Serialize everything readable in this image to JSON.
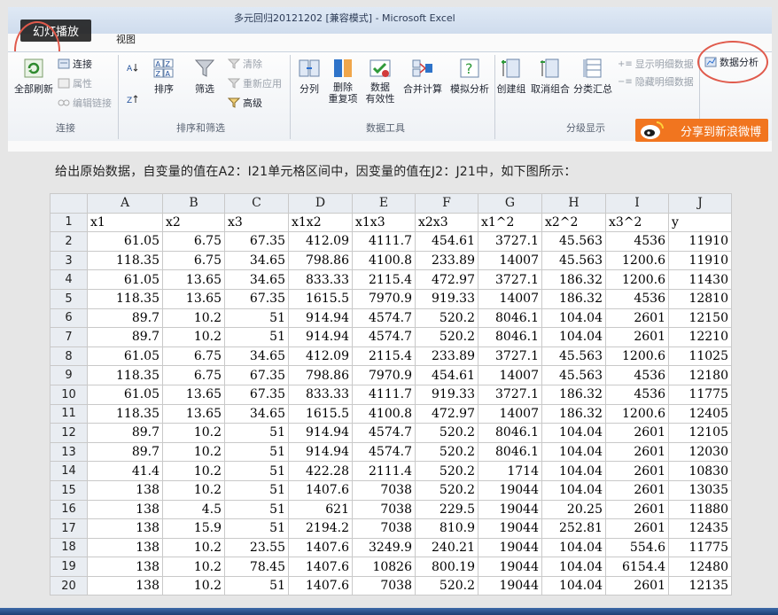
{
  "window": {
    "title": "多元回归20121202  [兼容模式]  -  Microsoft Excel"
  },
  "overlay": {
    "slideshow_label": "幻灯播放"
  },
  "tabs": [
    "视图"
  ],
  "ribbon": {
    "connections": {
      "refresh_all": "全部刷新",
      "connect": "连接",
      "properties": "属性",
      "edit_links": "编辑链接",
      "group": "连接"
    },
    "sort_filter": {
      "sort": "排序",
      "filter": "筛选",
      "clear": "清除",
      "reapply": "重新应用",
      "advanced": "高级",
      "group": "排序和筛选"
    },
    "data_tools": {
      "text_to_columns": "分列",
      "remove_duplicates_1": "删除",
      "remove_duplicates_2": "重复项",
      "validation_1": "数据",
      "validation_2": "有效性",
      "consolidate": "合并计算",
      "what_if": "模拟分析",
      "group": "数据工具"
    },
    "outline": {
      "group_btn": "创建组",
      "ungroup": "取消组合",
      "subtotal": "分类汇总",
      "show_detail": "显示明细数据",
      "hide_detail": "隐藏明细数据",
      "group": "分级显示"
    },
    "analysis": {
      "data_analysis": "数据分析"
    }
  },
  "share": {
    "label": "分享到新浪微博"
  },
  "caption": "给出原始数据，自变量的值在A2：I21单元格区间中，因变量的值在J2：J21中，如下图所示：",
  "sheet": {
    "columns": [
      "A",
      "B",
      "C",
      "D",
      "E",
      "F",
      "G",
      "H",
      "I",
      "J"
    ],
    "rows": [
      {
        "num": "1",
        "cells": [
          "x1",
          "x2",
          "x3",
          "x1x2",
          "x1x3",
          "x2x3",
          "x1^2",
          "x2^2",
          "x3^2",
          "y"
        ]
      },
      {
        "num": "2",
        "cells": [
          "61.05",
          "6.75",
          "67.35",
          "412.09",
          "4111.7",
          "454.61",
          "3727.1",
          "45.563",
          "4536",
          "11910"
        ]
      },
      {
        "num": "3",
        "cells": [
          "118.35",
          "6.75",
          "34.65",
          "798.86",
          "4100.8",
          "233.89",
          "14007",
          "45.563",
          "1200.6",
          "11910"
        ]
      },
      {
        "num": "4",
        "cells": [
          "61.05",
          "13.65",
          "34.65",
          "833.33",
          "2115.4",
          "472.97",
          "3727.1",
          "186.32",
          "1200.6",
          "11430"
        ]
      },
      {
        "num": "5",
        "cells": [
          "118.35",
          "13.65",
          "67.35",
          "1615.5",
          "7970.9",
          "919.33",
          "14007",
          "186.32",
          "4536",
          "12810"
        ]
      },
      {
        "num": "6",
        "cells": [
          "89.7",
          "10.2",
          "51",
          "914.94",
          "4574.7",
          "520.2",
          "8046.1",
          "104.04",
          "2601",
          "12150"
        ]
      },
      {
        "num": "7",
        "cells": [
          "89.7",
          "10.2",
          "51",
          "914.94",
          "4574.7",
          "520.2",
          "8046.1",
          "104.04",
          "2601",
          "12210"
        ]
      },
      {
        "num": "8",
        "cells": [
          "61.05",
          "6.75",
          "34.65",
          "412.09",
          "2115.4",
          "233.89",
          "3727.1",
          "45.563",
          "1200.6",
          "11025"
        ]
      },
      {
        "num": "9",
        "cells": [
          "118.35",
          "6.75",
          "67.35",
          "798.86",
          "7970.9",
          "454.61",
          "14007",
          "45.563",
          "4536",
          "12180"
        ]
      },
      {
        "num": "10",
        "cells": [
          "61.05",
          "13.65",
          "67.35",
          "833.33",
          "4111.7",
          "919.33",
          "3727.1",
          "186.32",
          "4536",
          "11775"
        ]
      },
      {
        "num": "11",
        "cells": [
          "118.35",
          "13.65",
          "34.65",
          "1615.5",
          "4100.8",
          "472.97",
          "14007",
          "186.32",
          "1200.6",
          "12405"
        ]
      },
      {
        "num": "12",
        "cells": [
          "89.7",
          "10.2",
          "51",
          "914.94",
          "4574.7",
          "520.2",
          "8046.1",
          "104.04",
          "2601",
          "12105"
        ]
      },
      {
        "num": "13",
        "cells": [
          "89.7",
          "10.2",
          "51",
          "914.94",
          "4574.7",
          "520.2",
          "8046.1",
          "104.04",
          "2601",
          "12030"
        ]
      },
      {
        "num": "14",
        "cells": [
          "41.4",
          "10.2",
          "51",
          "422.28",
          "2111.4",
          "520.2",
          "1714",
          "104.04",
          "2601",
          "10830"
        ]
      },
      {
        "num": "15",
        "cells": [
          "138",
          "10.2",
          "51",
          "1407.6",
          "7038",
          "520.2",
          "19044",
          "104.04",
          "2601",
          "13035"
        ]
      },
      {
        "num": "16",
        "cells": [
          "138",
          "4.5",
          "51",
          "621",
          "7038",
          "229.5",
          "19044",
          "20.25",
          "2601",
          "11880"
        ]
      },
      {
        "num": "17",
        "cells": [
          "138",
          "15.9",
          "51",
          "2194.2",
          "7038",
          "810.9",
          "19044",
          "252.81",
          "2601",
          "12435"
        ]
      },
      {
        "num": "18",
        "cells": [
          "138",
          "10.2",
          "23.55",
          "1407.6",
          "3249.9",
          "240.21",
          "19044",
          "104.04",
          "554.6",
          "11775"
        ]
      },
      {
        "num": "19",
        "cells": [
          "138",
          "10.2",
          "78.45",
          "1407.6",
          "10826",
          "800.19",
          "19044",
          "104.04",
          "6154.4",
          "12480"
        ]
      },
      {
        "num": "20",
        "cells": [
          "138",
          "10.2",
          "51",
          "1407.6",
          "7038",
          "520.2",
          "19044",
          "104.04",
          "2601",
          "12135"
        ]
      }
    ]
  }
}
